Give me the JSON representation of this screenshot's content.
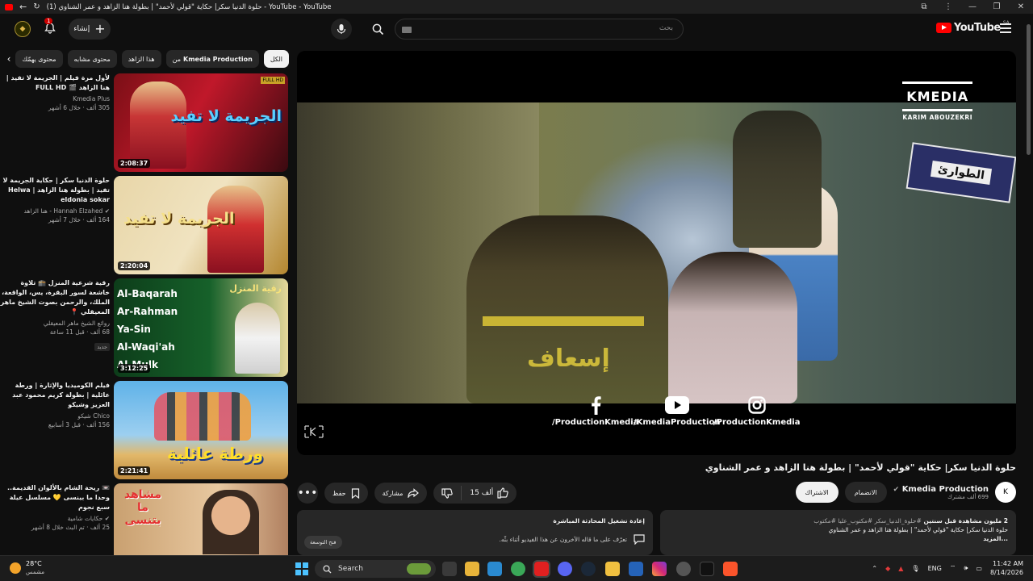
{
  "browser": {
    "tab_title": "حلوة الدنيا سكر| حكاية \"قولي لأحمد\" | بطولة هنا الزاهد و عمر الشناوي (1) - YouTube - YouTube"
  },
  "masthead": {
    "logo_text": "YouTube",
    "region": "SA",
    "search_placeholder": "بحث",
    "create_label": "إنشاء",
    "notifications_count": "1"
  },
  "chips": [
    {
      "label": "الكل",
      "active": true
    },
    {
      "label_prefix": "من",
      "label_bold": "Kmedia Production",
      "active": false
    },
    {
      "label": "هذا الزاهد",
      "active": false
    },
    {
      "label": "محتوى مشابه",
      "active": false
    },
    {
      "label": "محتوى يهمّك",
      "active": false
    }
  ],
  "recommendations": [
    {
      "title": "لأول مرة فيلم | الجريمة لا تفيد | هنا الزاهد 🎬 FULL HD",
      "channel": "Kmedia Plus",
      "stats": "305 ألف  ·  خلال 6 أشهر",
      "duration": "2:08:37",
      "thumb_text": "الجريمة لا تفيد",
      "badge": ""
    },
    {
      "title": "حلوة الدنيا سكر | حكاية الجريمة لا تفيد | بطولة هنا الزاهد | Helwa eldonia sokar",
      "channel": "Hannah Elzahed - هنا الزاهد",
      "stats": "164 ألف  ·  خلال 7 أشهر",
      "duration": "2:20:04",
      "thumb_text": "الجريمة لا تفيد",
      "badge": ""
    },
    {
      "title": "رقية شرعية المنزل 🕋 تلاوة خاشعة لسور البقرة، يس، الواقعة، الملك، والرحمن بصوت الشيخ ماهر المعيقلي 📍",
      "channel": "روائع الشيخ ماهر المعيقلي",
      "stats": "68 ألف  ·  قبل 11 ساعة",
      "duration": "3:12:25",
      "thumb_text": "رقية المنزل",
      "badge": "جديد"
    },
    {
      "title": "فيلم الكوميديا والإثارة | ورطة عائلية | بطولة كريم محمود عبد العزيز وشيكو",
      "channel": "Chico شيكو",
      "stats": "156 ألف  ·  قبل 3 أسابيع",
      "duration": "2:21:41",
      "thumb_text": "ورطة عائلية",
      "badge": ""
    },
    {
      "title": "📼 ريحة الشام بالألوان القديمة.. وحدا ما بينسى 💛 مسلسل عيلة سبع نجوم",
      "channel": "حكايات شامية",
      "stats": "25 ألف  ·  تم البث خلال 8 أشهر",
      "duration": "",
      "thumb_text": "مشاهد ما بتنسى",
      "badge": ""
    }
  ],
  "player": {
    "watermark_logo": "KMEDIA",
    "watermark_name": "KARIM ABOUZEKRI",
    "scene_sign": "الطوارئ",
    "uniform_text": "إسعاف",
    "social": [
      {
        "icon": "facebook-icon",
        "handle": "/ProductionKmedia"
      },
      {
        "icon": "youtube-icon",
        "handle": "/KmediaProduction"
      },
      {
        "icon": "instagram-icon",
        "handle": "/ProductionKmedia"
      }
    ]
  },
  "video": {
    "title": "حلوة الدنيا سكر| حكاية \"قولي لأحمد\" | بطولة هنا الزاهد و عمر الشناوي",
    "channel_name": "Kmedia Production",
    "subscribers": "699 ألف مشترك",
    "join_label": "الانضمام",
    "subscribe_label": "الاشتراك",
    "likes": "15 ألف",
    "share_label": "مشاركة",
    "save_label": "حفظ"
  },
  "description": {
    "header": "2 مليون مشاهدة  قبل سنتين",
    "hashtags": "#حلوة_الدنيا_سكر #مكتوب_عليا #مكتوب",
    "body": "حلوة الدنيا سكر| حكاية \"قولي لأحمد\" | بطولة هنا الزاهد و عمر الشناوي",
    "more": "...المزيد"
  },
  "chat": {
    "title": "إعادة تشغيل المحادثة المباشرة",
    "body": "تعرّف على ما قاله الآخرون عن هذا الفيديو أثناء بثّه.",
    "button": "فتح التوسعة"
  },
  "taskbar": {
    "temp": "28°C",
    "weather": "مشمس",
    "search_label": "Search",
    "lang": "ENG",
    "time": "11:42 AM",
    "date": "8/14/2026"
  }
}
